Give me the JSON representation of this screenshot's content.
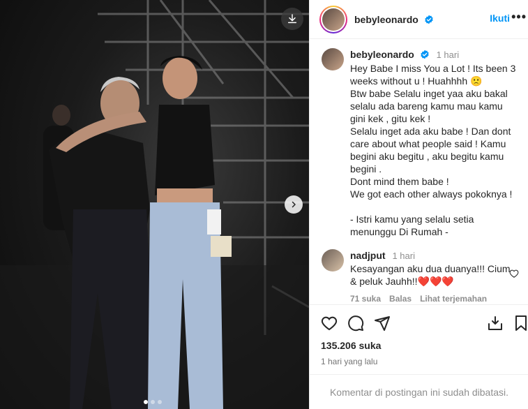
{
  "post": {
    "username": "bebyleonardo",
    "follow_label": "Ikuti",
    "more_label": "•••",
    "caption_time": "1 hari",
    "caption_text": "Hey Babe I miss You a Lot ! Its been 3 weeks without u ! Huahhhh 🙁\nBtw babe Selalu inget yaa aku bakal selalu ada bareng kamu mau kamu gini kek , gitu kek !\nSelalu inget ada aku babe ! Dan dont care about what people said ! Kamu begini aku begitu , aku begitu kamu begini .\nDont mind them babe !\nWe got each other always pokoknya !\n\n- Istri kamu yang selalu setia menunggu Di Rumah -",
    "likes": "135.206 suka",
    "date": "1 hari yang lalu",
    "comments_disabled": "Komentar di postingan ini sudah dibatasi."
  },
  "comment": {
    "username": "nadjput",
    "time": "1 hari",
    "text": "Kesayangan aku dua duanya!!! Cium & peluk Jauhh!!",
    "hearts": "❤️❤️❤️",
    "like_count": "71 suka",
    "reply_label": "Balas",
    "translate_label": "Lihat terjemahan"
  },
  "carousel": {
    "dots": 3,
    "active_index": 0
  },
  "icons": {
    "download": "download-icon",
    "next": "chevron-right-icon",
    "like": "heart-icon",
    "comment": "comment-icon",
    "share": "send-icon",
    "save_to_collection": "inbox-download-icon",
    "bookmark": "bookmark-icon",
    "verified": "verified-badge-icon"
  },
  "colors": {
    "accent": "#0095f6",
    "verified": "#0095f6",
    "heart": "#e41e3f",
    "muted": "#8e8e8e"
  }
}
